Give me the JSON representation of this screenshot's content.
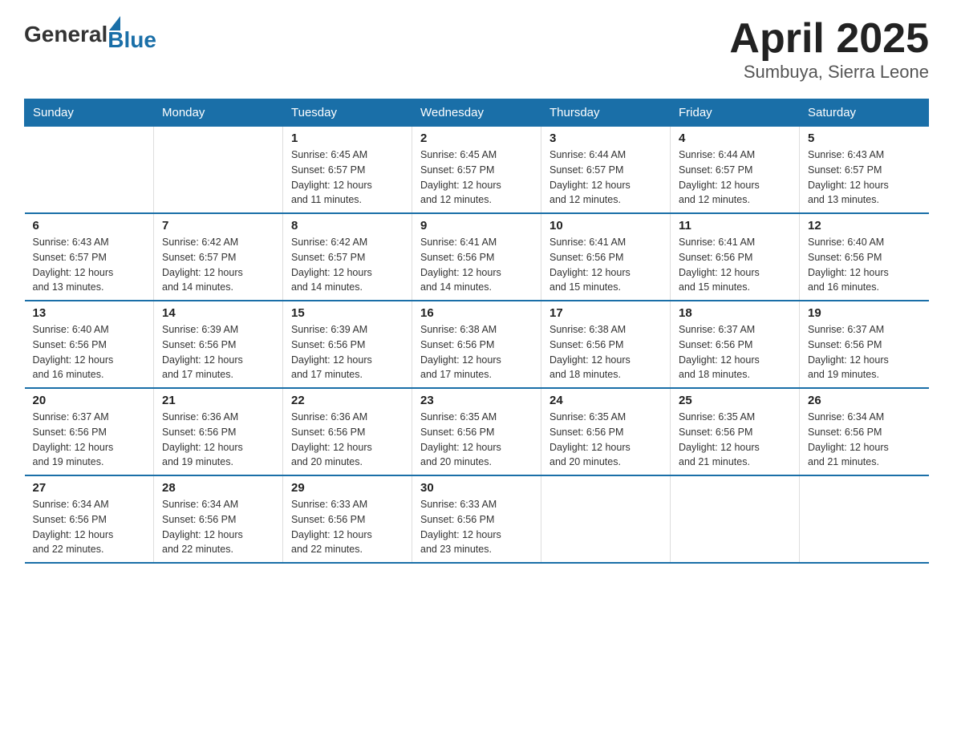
{
  "logo": {
    "general": "General",
    "blue": "Blue"
  },
  "title": "April 2025",
  "subtitle": "Sumbuya, Sierra Leone",
  "days_header": [
    "Sunday",
    "Monday",
    "Tuesday",
    "Wednesday",
    "Thursday",
    "Friday",
    "Saturday"
  ],
  "weeks": [
    [
      {
        "day": "",
        "info": ""
      },
      {
        "day": "",
        "info": ""
      },
      {
        "day": "1",
        "info": "Sunrise: 6:45 AM\nSunset: 6:57 PM\nDaylight: 12 hours\nand 11 minutes."
      },
      {
        "day": "2",
        "info": "Sunrise: 6:45 AM\nSunset: 6:57 PM\nDaylight: 12 hours\nand 12 minutes."
      },
      {
        "day": "3",
        "info": "Sunrise: 6:44 AM\nSunset: 6:57 PM\nDaylight: 12 hours\nand 12 minutes."
      },
      {
        "day": "4",
        "info": "Sunrise: 6:44 AM\nSunset: 6:57 PM\nDaylight: 12 hours\nand 12 minutes."
      },
      {
        "day": "5",
        "info": "Sunrise: 6:43 AM\nSunset: 6:57 PM\nDaylight: 12 hours\nand 13 minutes."
      }
    ],
    [
      {
        "day": "6",
        "info": "Sunrise: 6:43 AM\nSunset: 6:57 PM\nDaylight: 12 hours\nand 13 minutes."
      },
      {
        "day": "7",
        "info": "Sunrise: 6:42 AM\nSunset: 6:57 PM\nDaylight: 12 hours\nand 14 minutes."
      },
      {
        "day": "8",
        "info": "Sunrise: 6:42 AM\nSunset: 6:57 PM\nDaylight: 12 hours\nand 14 minutes."
      },
      {
        "day": "9",
        "info": "Sunrise: 6:41 AM\nSunset: 6:56 PM\nDaylight: 12 hours\nand 14 minutes."
      },
      {
        "day": "10",
        "info": "Sunrise: 6:41 AM\nSunset: 6:56 PM\nDaylight: 12 hours\nand 15 minutes."
      },
      {
        "day": "11",
        "info": "Sunrise: 6:41 AM\nSunset: 6:56 PM\nDaylight: 12 hours\nand 15 minutes."
      },
      {
        "day": "12",
        "info": "Sunrise: 6:40 AM\nSunset: 6:56 PM\nDaylight: 12 hours\nand 16 minutes."
      }
    ],
    [
      {
        "day": "13",
        "info": "Sunrise: 6:40 AM\nSunset: 6:56 PM\nDaylight: 12 hours\nand 16 minutes."
      },
      {
        "day": "14",
        "info": "Sunrise: 6:39 AM\nSunset: 6:56 PM\nDaylight: 12 hours\nand 17 minutes."
      },
      {
        "day": "15",
        "info": "Sunrise: 6:39 AM\nSunset: 6:56 PM\nDaylight: 12 hours\nand 17 minutes."
      },
      {
        "day": "16",
        "info": "Sunrise: 6:38 AM\nSunset: 6:56 PM\nDaylight: 12 hours\nand 17 minutes."
      },
      {
        "day": "17",
        "info": "Sunrise: 6:38 AM\nSunset: 6:56 PM\nDaylight: 12 hours\nand 18 minutes."
      },
      {
        "day": "18",
        "info": "Sunrise: 6:37 AM\nSunset: 6:56 PM\nDaylight: 12 hours\nand 18 minutes."
      },
      {
        "day": "19",
        "info": "Sunrise: 6:37 AM\nSunset: 6:56 PM\nDaylight: 12 hours\nand 19 minutes."
      }
    ],
    [
      {
        "day": "20",
        "info": "Sunrise: 6:37 AM\nSunset: 6:56 PM\nDaylight: 12 hours\nand 19 minutes."
      },
      {
        "day": "21",
        "info": "Sunrise: 6:36 AM\nSunset: 6:56 PM\nDaylight: 12 hours\nand 19 minutes."
      },
      {
        "day": "22",
        "info": "Sunrise: 6:36 AM\nSunset: 6:56 PM\nDaylight: 12 hours\nand 20 minutes."
      },
      {
        "day": "23",
        "info": "Sunrise: 6:35 AM\nSunset: 6:56 PM\nDaylight: 12 hours\nand 20 minutes."
      },
      {
        "day": "24",
        "info": "Sunrise: 6:35 AM\nSunset: 6:56 PM\nDaylight: 12 hours\nand 20 minutes."
      },
      {
        "day": "25",
        "info": "Sunrise: 6:35 AM\nSunset: 6:56 PM\nDaylight: 12 hours\nand 21 minutes."
      },
      {
        "day": "26",
        "info": "Sunrise: 6:34 AM\nSunset: 6:56 PM\nDaylight: 12 hours\nand 21 minutes."
      }
    ],
    [
      {
        "day": "27",
        "info": "Sunrise: 6:34 AM\nSunset: 6:56 PM\nDaylight: 12 hours\nand 22 minutes."
      },
      {
        "day": "28",
        "info": "Sunrise: 6:34 AM\nSunset: 6:56 PM\nDaylight: 12 hours\nand 22 minutes."
      },
      {
        "day": "29",
        "info": "Sunrise: 6:33 AM\nSunset: 6:56 PM\nDaylight: 12 hours\nand 22 minutes."
      },
      {
        "day": "30",
        "info": "Sunrise: 6:33 AM\nSunset: 6:56 PM\nDaylight: 12 hours\nand 23 minutes."
      },
      {
        "day": "",
        "info": ""
      },
      {
        "day": "",
        "info": ""
      },
      {
        "day": "",
        "info": ""
      }
    ]
  ]
}
